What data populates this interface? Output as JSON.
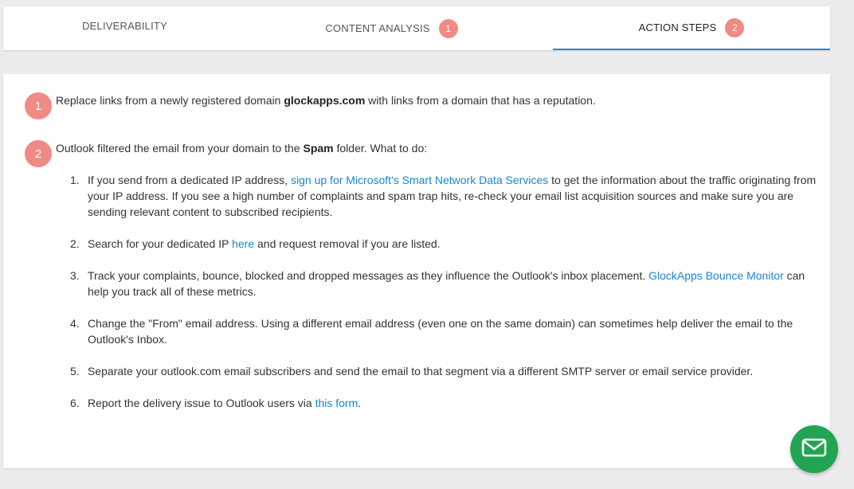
{
  "tabs": [
    {
      "label": "DELIVERABILITY",
      "badge": ""
    },
    {
      "label": "CONTENT ANALYSIS",
      "badge": "1"
    },
    {
      "label": "ACTION STEPS",
      "badge": "2"
    }
  ],
  "colors": {
    "accent": "#2d86d4",
    "badge": "#f08a84",
    "link": "#1a85d0",
    "fab": "#22a453"
  },
  "steps": [
    {
      "number": "1",
      "text_before": "Replace links from a newly registered domain ",
      "bold": "glockapps.com",
      "text_after": " with links from a domain that has a reputation."
    },
    {
      "number": "2",
      "text_before": "Outlook filtered the email from your domain to the ",
      "bold": "Spam",
      "text_after": " folder. What to do:"
    }
  ],
  "actions": [
    {
      "num": "1.",
      "before": "If you send from a dedicated IP address, ",
      "link": "sign up for Microsoft's Smart Network Data Services",
      "after": " to get the information about the traffic originating from your IP address. If you see a high number of complaints and spam trap hits, re-check your email list acquisition sources and make sure you are sending relevant content to subscribed recipients."
    },
    {
      "num": "2.",
      "before": "Search for your dedicated IP ",
      "link": "here",
      "after": " and request removal if you are listed."
    },
    {
      "num": "3.",
      "before": "Track your complaints, bounce, blocked and dropped messages as they influence the Outlook's inbox placement. ",
      "link": "GlockApps Bounce Monitor",
      "after": " can help you track all of these metrics."
    },
    {
      "num": "4.",
      "before": "Change the \"From\" email address. Using a different email address (even one on the same domain) can sometimes help deliver the email to the Outlook's Inbox.",
      "link": "",
      "after": ""
    },
    {
      "num": "5.",
      "before": "Separate your outlook.com email subscribers and send the email to that segment via a different SMTP server or email service provider.",
      "link": "",
      "after": ""
    },
    {
      "num": "6.",
      "before": "Report the delivery issue to Outlook users via ",
      "link": "this form",
      "after": "."
    }
  ],
  "fab": {
    "icon": "mail-icon"
  }
}
